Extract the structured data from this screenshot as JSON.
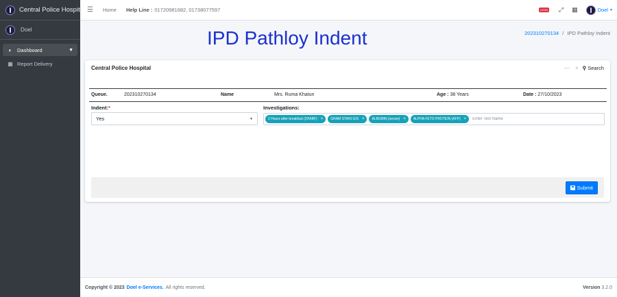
{
  "brand": {
    "name": "Central Police Hospital"
  },
  "user_panel": {
    "name": "Doel"
  },
  "sidebar": {
    "items": [
      {
        "label": "Dashboard"
      },
      {
        "label": "Report Delivery"
      }
    ]
  },
  "navbar": {
    "home": "Home",
    "helpline_label": "Help Line :",
    "helpline_value": "01720981682, 01738077597",
    "badge": "LEON",
    "user": "Doel"
  },
  "page": {
    "title": "IPD Pathloy Indent",
    "breadcrumb_link": "202310270134",
    "breadcrumb_sep": "/",
    "breadcrumb_current": "IPD Pathloy Indent"
  },
  "card": {
    "title": "Central Police Hospital",
    "minimize": "—",
    "close": "×",
    "search_label": "Search"
  },
  "patient": {
    "queue_label": "Queue.",
    "queue_value": "202310270134",
    "name_label": "Name",
    "name_value": "Mrs. Ruma Khatun",
    "age_label": "Age :",
    "age_value": "38 Years",
    "date_label": "Date :",
    "date_value": "27/10/2023"
  },
  "form": {
    "indent_label": "Indent:",
    "indent_required": "*",
    "indent_value": "Yes",
    "investigations_label": "Investigations:",
    "tags": [
      "2 Hours after breakfast (2HABF)",
      "GRAM STAIN G/S",
      "ALBUMIN (serum)",
      "ALPHA FETO PROTEIN (AFP)"
    ],
    "test_placeholder": "Enter Test Name",
    "submit_label": "Submit"
  },
  "footer": {
    "copyright": "Copyright © 2023",
    "company": "Doel e-Services.",
    "rights": "All rights reserved.",
    "version_label": "Version",
    "version_value": "3.2.0"
  },
  "colors": {
    "sidebar": "#343a40",
    "title": "#1a2fd0",
    "tag": "#17a2b8",
    "primary": "#007bff"
  }
}
